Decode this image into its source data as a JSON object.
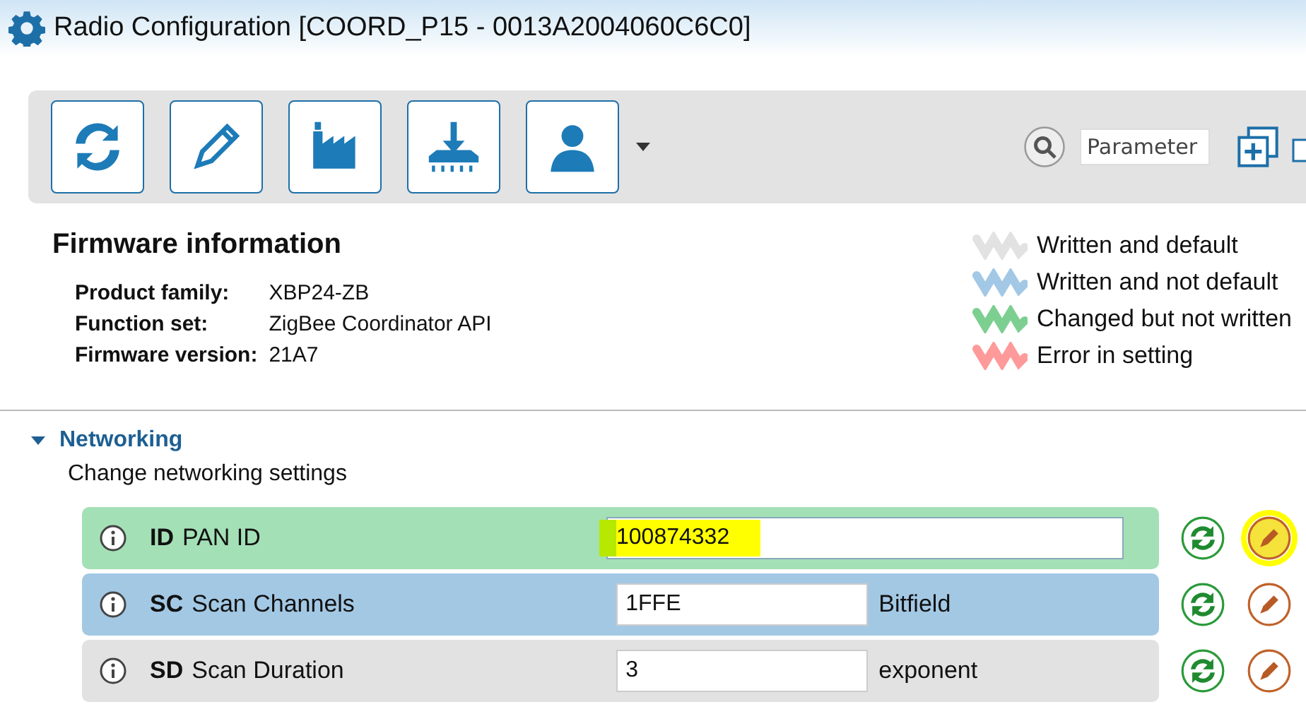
{
  "window": {
    "title": "Radio Configuration [COORD_P15 - 0013A2004060C6C0]"
  },
  "toolbar": {
    "buttons": [
      {
        "kind": "read"
      },
      {
        "kind": "write"
      },
      {
        "kind": "default"
      },
      {
        "kind": "update"
      },
      {
        "kind": "profile"
      }
    ],
    "search": {
      "placeholder": "Parameter"
    }
  },
  "firmware": {
    "title": "Firmware information",
    "fields": [
      {
        "label": "Product family:",
        "value": "XBP24-ZB"
      },
      {
        "label": "Function set:",
        "value": "ZigBee Coordinator API"
      },
      {
        "label": "Firmware version:",
        "value": "21A7"
      }
    ]
  },
  "legend": [
    {
      "label": "Written and default",
      "color": "#e2e2e2"
    },
    {
      "label": "Written and not default",
      "color": "#a3c8e6"
    },
    {
      "label": "Changed but not written",
      "color": "#7ccf90"
    },
    {
      "label": "Error in setting",
      "color": "#ff9a9a"
    }
  ],
  "section": {
    "title": "Networking",
    "expanded": true,
    "description": "Change networking settings",
    "rows": [
      {
        "code": "ID",
        "name": "PAN ID",
        "value": "100874332",
        "unit": "",
        "color": "#a4e0b6",
        "highlighted": true
      },
      {
        "code": "SC",
        "name": "Scan Channels",
        "value": "1FFE",
        "unit": "Bitfield",
        "color": "#a3c8e4",
        "highlighted": false
      },
      {
        "code": "SD",
        "name": "Scan Duration",
        "value": "3",
        "unit": "exponent",
        "color": "#e2e2e2",
        "highlighted": false
      }
    ]
  }
}
